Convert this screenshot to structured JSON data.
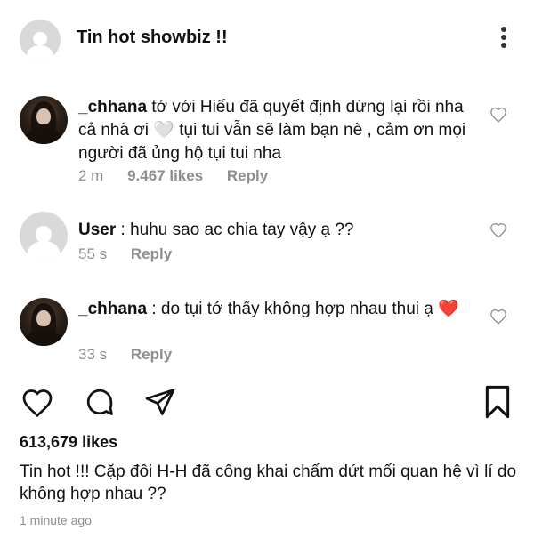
{
  "header": {
    "title": "Tin hot showbiz !!"
  },
  "comments": [
    {
      "username": "_chhana",
      "text": "tớ với Hiếu đã quyết định dừng lại rồi nha cả nhà ơi 🤍 tụi tui vẫn sẽ làm bạn nè , cảm ơn mọi người đã ủng hộ tụi tui nha",
      "time": "2 m",
      "likes": "9.467 likes",
      "reply": "Reply"
    },
    {
      "username": "User",
      "text": ": huhu sao ac chia tay vậy ạ ??",
      "time": "55 s",
      "reply": "Reply"
    },
    {
      "username": "_chhana",
      "text": ": do tụi tớ thấy không hợp nhau thui ạ ❤️",
      "time": "33 s",
      "reply": "Reply"
    }
  ],
  "post": {
    "likes": "613,679 likes",
    "caption": "Tin hot !!! Cặp đôi H-H đã công khai chấm dứt mối quan hệ vì lí do không hợp nhau ??",
    "time": "1 minute ago"
  },
  "icons": {
    "menu": "more-vertical-icon",
    "like": "heart-icon",
    "comment": "comment-icon",
    "share": "send-icon",
    "save": "bookmark-icon"
  },
  "colors": {
    "text": "#111111",
    "muted": "#8e8e8e",
    "heart_red": "#e0245e"
  }
}
